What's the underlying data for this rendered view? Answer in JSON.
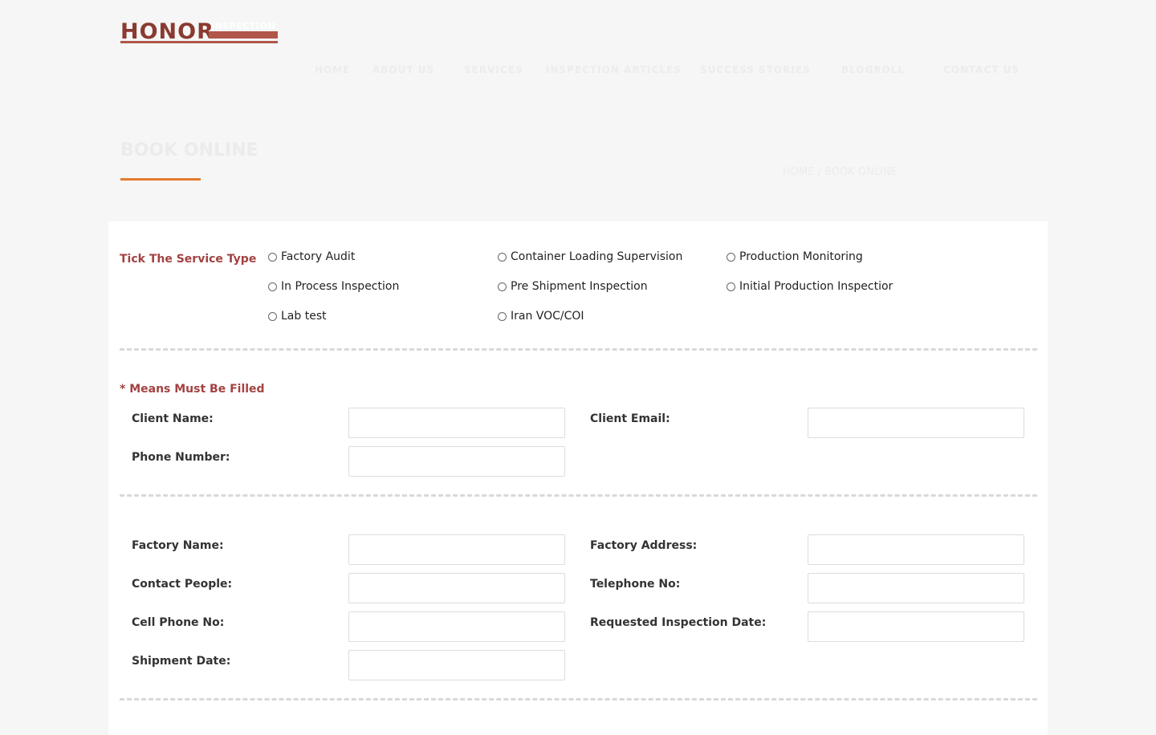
{
  "logo": {
    "primary": "HONOR",
    "secondary": "INSPECTION"
  },
  "nav": [
    {
      "label": "HOME"
    },
    {
      "label": "ABOUT US"
    },
    {
      "label": "SERVICES"
    },
    {
      "label": "INSPECTION ARTICLES"
    },
    {
      "label": "SUCCESS STORIES"
    },
    {
      "label": "BLOGROLL"
    },
    {
      "label": "CONTACT US"
    }
  ],
  "page": {
    "heading": "BOOK ONLINE",
    "breadcrumb": "HOME / BOOK ONLINE"
  },
  "service": {
    "label": "Tick The Service Type",
    "options": [
      "Factory Audit",
      "Container Loading Supervision",
      "Production Monitoring",
      "In Process Inspection",
      "Pre Shipment Inspection",
      "Initial Production Inspectior",
      "Lab test",
      "Iran VOC/COI"
    ]
  },
  "client": {
    "required_note": "* Means Must Be Filled",
    "name_label": "Client Name:",
    "email_label": "Client Email:",
    "phone_label": "Phone Number:",
    "name_value": "",
    "email_value": "",
    "phone_value": ""
  },
  "factory": {
    "name_label": "Factory Name:",
    "address_label": "Factory Address:",
    "contact_label": "Contact People:",
    "telephone_label": "Telephone No:",
    "cell_label": "Cell Phone No:",
    "inspection_date_label": "Requested Inspection Date:",
    "shipment_date_label": "Shipment Date:",
    "name_value": "",
    "address_value": "",
    "contact_value": "",
    "telephone_value": "",
    "cell_value": "",
    "inspection_date_value": "",
    "shipment_date_value": ""
  },
  "colors": {
    "accent": "#a34242",
    "underline": "#e47b2e",
    "brand": "#8a3a30"
  }
}
